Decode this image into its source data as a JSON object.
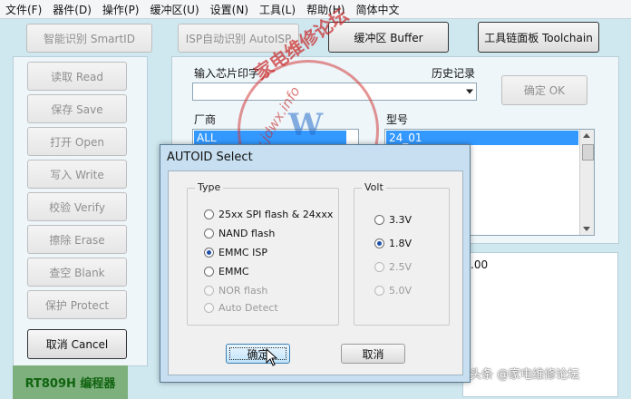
{
  "menu": [
    "文件(F)",
    "器件(D)",
    "操作(P)",
    "缓冲区(U)",
    "设置(N)",
    "工具(L)",
    "帮助(H)",
    "简体中文"
  ],
  "toolbar": {
    "smartid": "智能识别 SmartID",
    "autoisp": "ISP自动识别 AutoISP",
    "buffer": "缓冲区 Buffer",
    "toolchain": "工具链面板 Toolchain"
  },
  "ops": {
    "read": "读取 Read",
    "save": "保存 Save",
    "open": "打开 Open",
    "write": "写入 Write",
    "verify": "校验 Verify",
    "erase": "擦除 Erase",
    "blank": "查空 Blank",
    "protect": "保护 Protect",
    "cancel": "取消 Cancel"
  },
  "brand": "RT809H 编程器",
  "chip": {
    "input_label": "输入芯片印字",
    "input_value": "",
    "history_label": "历史记录",
    "confirm": "确定 OK",
    "vendor_label": "厂商",
    "vendor_value": "ALL",
    "model_label": "型号",
    "model_value": "24_01",
    "info_fragment": ".00"
  },
  "dialog": {
    "title": "AUTOID Select",
    "type_label": "Type",
    "volt_label": "Volt",
    "types": [
      {
        "label": "25xx SPI flash & 24xxx",
        "selected": false,
        "enabled": true
      },
      {
        "label": "NAND flash",
        "selected": false,
        "enabled": true
      },
      {
        "label": "EMMC ISP",
        "selected": true,
        "enabled": true
      },
      {
        "label": "EMMC",
        "selected": false,
        "enabled": true
      },
      {
        "label": "NOR flash",
        "selected": false,
        "enabled": false
      },
      {
        "label": "Auto Detect",
        "selected": false,
        "enabled": false
      }
    ],
    "volts": [
      {
        "label": "3.3V",
        "selected": false,
        "enabled": true
      },
      {
        "label": "1.8V",
        "selected": true,
        "enabled": true
      },
      {
        "label": "2.5V",
        "selected": false,
        "enabled": false
      },
      {
        "label": "5.0V",
        "selected": false,
        "enabled": false
      }
    ],
    "ok": "确定",
    "cancel": "取消"
  },
  "watermark": {
    "site": "家电维修论坛",
    "url": "www.jdwx.info",
    "mark": "W"
  },
  "credit": "头条 @家电维修论坛"
}
